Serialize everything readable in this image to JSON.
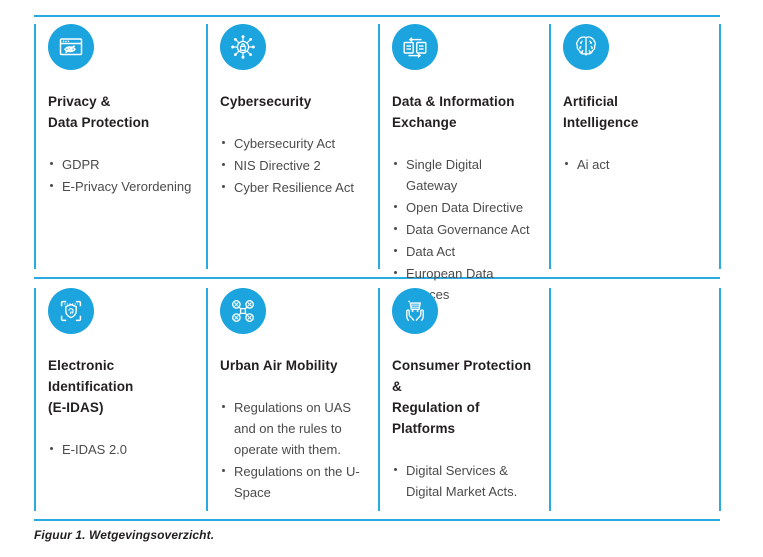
{
  "figure": {
    "caption": "Figuur 1. Wetgevingsoverzicht.",
    "accent_color": "#29ABE2",
    "icon_badge_color": "#1CA4DE",
    "heading_color": "#231f20",
    "body_color": "#4b4b4b"
  },
  "rows": [
    {
      "cells": [
        {
          "icon": "privacy-browser-eye-icon",
          "title": "Privacy &\nData Protection",
          "items": [
            "GDPR",
            "E-Privacy Verordening"
          ]
        },
        {
          "icon": "cybersecurity-network-lock-icon",
          "title": "Cybersecurity",
          "items": [
            "Cybersecurity Act",
            "NIS Directive 2",
            "Cyber Resilience Act"
          ]
        },
        {
          "icon": "data-exchange-documents-icon",
          "title": "Data & Information\nExchange",
          "items": [
            "Single Digital Gateway",
            "Open Data Directive",
            "Data Governance Act",
            "Data Act",
            "European Data Spaces"
          ]
        },
        {
          "icon": "artificial-intelligence-brain-icon",
          "title": "Artificial\nIntelligence",
          "items": [
            "Ai act"
          ]
        }
      ]
    },
    {
      "cells": [
        {
          "icon": "electronic-identification-scan-shield-icon",
          "title": "Electronic Identification\n(E-IDAS)",
          "items": [
            "E-IDAS 2.0"
          ]
        },
        {
          "icon": "urban-air-mobility-drone-icon",
          "title": "Urban Air Mobility",
          "items": [
            "Regulations on UAS and on the rules to operate with them.",
            "Regulations on the U-Space"
          ]
        },
        {
          "icon": "consumer-protection-cart-hands-icon",
          "title": "Consumer Protection &\nRegulation of Platforms",
          "items": [
            "Digital Services & Digital Market Acts."
          ]
        },
        {
          "icon": "",
          "title": "",
          "items": []
        }
      ]
    }
  ]
}
